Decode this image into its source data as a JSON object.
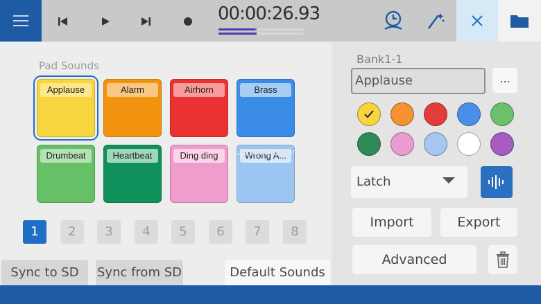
{
  "transport": {
    "time": "00:00:26.93",
    "meter_top_level": 0.45,
    "meter_bottom_level": 0.45
  },
  "icons": {
    "menu": "hamburger-menu-icon",
    "prev": "skip-previous-icon",
    "play": "play-icon",
    "next": "skip-next-icon",
    "record": "record-icon",
    "timer": "timer-icon",
    "magic": "magic-wand-icon",
    "close": "close-icon",
    "folder": "folder-icon",
    "wave": "waveform-icon",
    "trash": "trash-icon"
  },
  "pads": {
    "label": "Pad Sounds",
    "items": [
      {
        "name": "Applause",
        "color": "#f6d53e",
        "tab": "#fbe88c"
      },
      {
        "name": "Alarm",
        "color": "#f2930f",
        "tab": "#f9c783"
      },
      {
        "name": "Airhorn",
        "color": "#ea3232",
        "tab": "#f79b9b"
      },
      {
        "name": "Brass",
        "color": "#3b8ce6",
        "tab": "#a7cdf5"
      },
      {
        "name": "Drumbeat",
        "color": "#66c066",
        "tab": "#b4e2b4"
      },
      {
        "name": "Heartbeat",
        "color": "#10905a",
        "tab": "#9fd7bd"
      },
      {
        "name": "Ding ding",
        "color": "#f09ccc",
        "tab": "#fbd3ea"
      },
      {
        "name": "Wrong A...",
        "color": "#9cc5f2",
        "tab": "#d6e8fa"
      }
    ]
  },
  "pages": [
    "1",
    "2",
    "3",
    "4",
    "5",
    "6",
    "7",
    "8"
  ],
  "buttons": {
    "sync_to_sd": "Sync to SD",
    "sync_from_sd": "Sync from SD",
    "default_sounds": "Default Sounds"
  },
  "watermark": "UpdateStar.com",
  "editor": {
    "bank": "Bank1-1",
    "name": "Applause",
    "more": "...",
    "mode": "Latch",
    "import": "Import",
    "export": "Export",
    "advanced": "Advanced"
  },
  "swatches": [
    "#f6d53e",
    "#f2932f",
    "#e43b3b",
    "#4b8ee8",
    "#6cc06c",
    "#2e8b57",
    "#ea9bd0",
    "#a7c7f0",
    "#ffffff",
    "#a65bbf"
  ]
}
